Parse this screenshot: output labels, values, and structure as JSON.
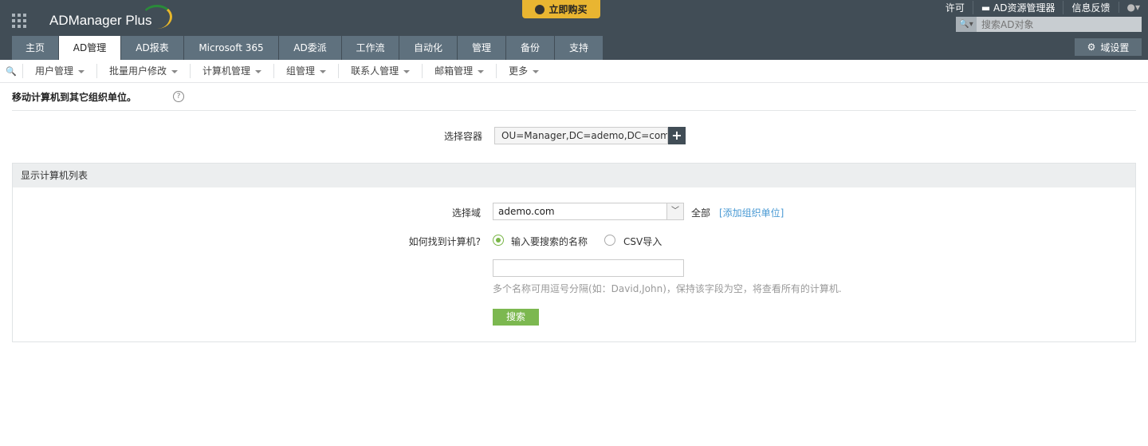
{
  "header": {
    "logo": "ADManager Plus",
    "buy": "立即购买",
    "links": [
      "许可",
      "AD资源管理器",
      "信息反馈"
    ],
    "search_placeholder": "搜索AD对象",
    "domain_settings": "域设置"
  },
  "tabs": [
    {
      "label": "主页"
    },
    {
      "label": "AD管理"
    },
    {
      "label": "AD报表"
    },
    {
      "label": "Microsoft 365"
    },
    {
      "label": "AD委派"
    },
    {
      "label": "工作流"
    },
    {
      "label": "自动化"
    },
    {
      "label": "管理"
    },
    {
      "label": "备份"
    },
    {
      "label": "支持"
    }
  ],
  "subnav": [
    "用户管理",
    "批量用户修改",
    "计算机管理",
    "组管理",
    "联系人管理",
    "邮箱管理",
    "更多"
  ],
  "page": {
    "title": "移动计算机到其它组织单位。",
    "container_label": "选择容器",
    "container_value": "OU=Manager,DC=ademo,DC=com",
    "panel_title": "显示计算机列表",
    "domain_label": "选择域",
    "domain_value": "ademo.com",
    "all": "全部",
    "add_ou": "[添加组织单位]",
    "find_label": "如何找到计算机?",
    "opt_name": "输入要搜索的名称",
    "opt_csv": "CSV导入",
    "hint": "多个名称可用逗号分隔(如：David,John)，保持该字段为空，将查看所有的计算机.",
    "search_btn": "搜索"
  }
}
